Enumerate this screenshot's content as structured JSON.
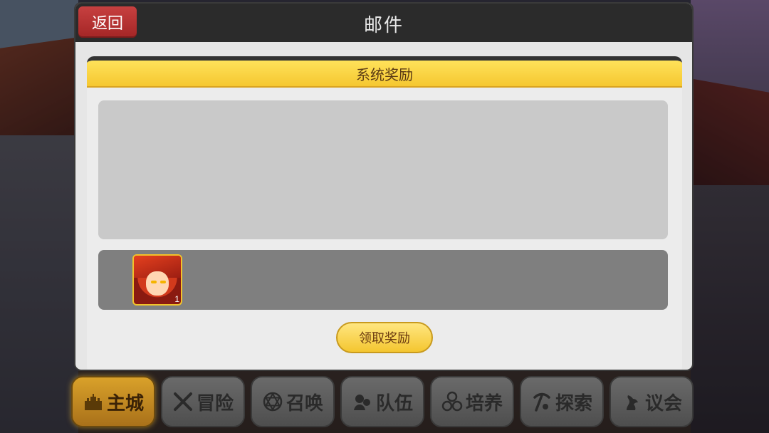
{
  "dialog": {
    "title": "邮件",
    "back_label": "返回"
  },
  "mail": {
    "subject": "系统奖励",
    "attachment": {
      "icon": "hero-portrait-icon",
      "count": "1"
    },
    "claim_label": "领取奖励"
  },
  "nav": {
    "items": [
      {
        "label": "主城",
        "icon": "castle-icon",
        "active": true
      },
      {
        "label": "冒险",
        "icon": "crossed-swords-icon",
        "active": false
      },
      {
        "label": "召唤",
        "icon": "hexagram-icon",
        "active": false
      },
      {
        "label": "队伍",
        "icon": "team-icon",
        "active": false
      },
      {
        "label": "培养",
        "icon": "three-orbs-icon",
        "active": false
      },
      {
        "label": "探索",
        "icon": "pickaxe-icon",
        "active": false
      },
      {
        "label": "议会",
        "icon": "dragon-icon",
        "active": false
      }
    ]
  },
  "colors": {
    "header_bg": "#2b2b2b",
    "back_button": "#b83030",
    "subject_bar": "#ffd940",
    "claim_button": "#f7d04a",
    "nav_active": "#c48a22"
  }
}
